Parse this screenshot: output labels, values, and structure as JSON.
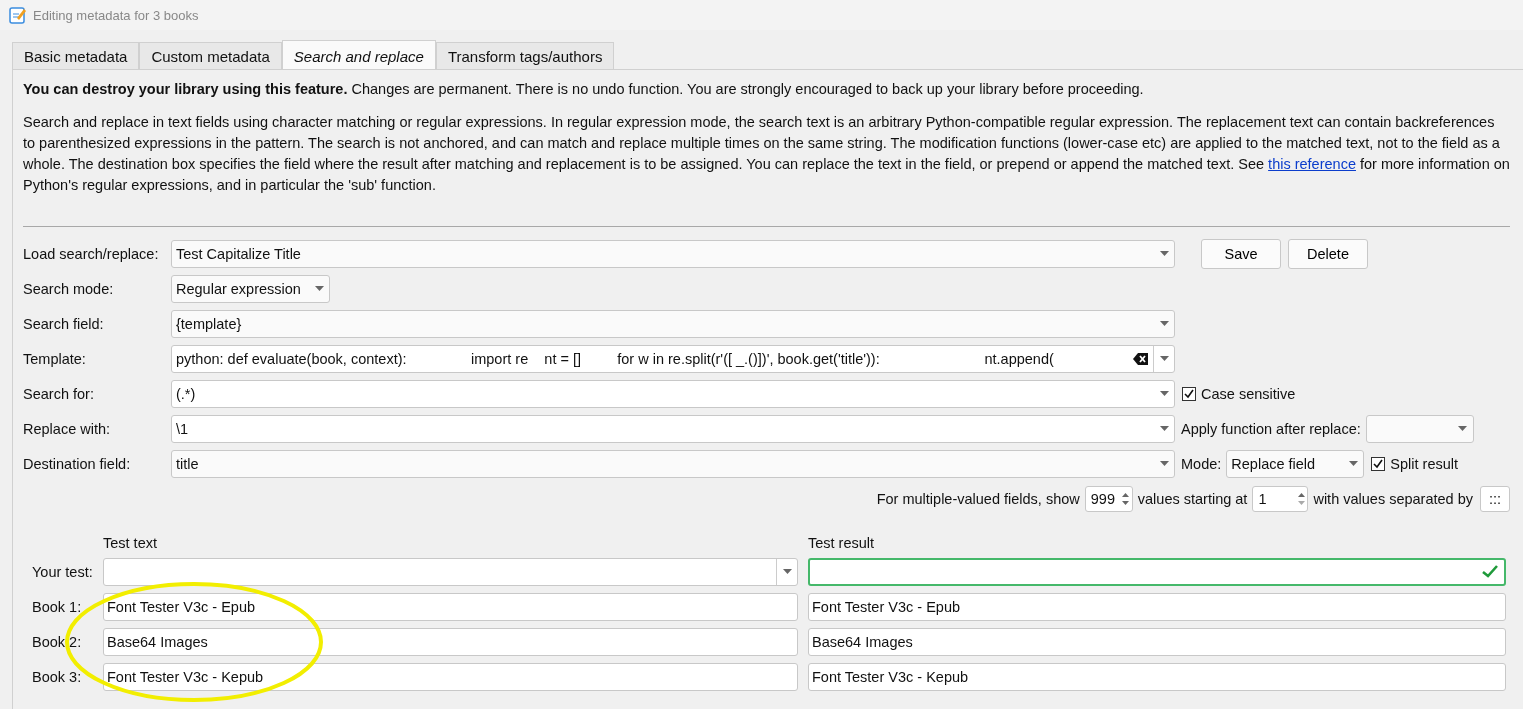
{
  "window": {
    "title": "Editing metadata for 3 books"
  },
  "tabs": [
    {
      "label": "Basic metadata",
      "selected": false
    },
    {
      "label": "Custom metadata",
      "selected": false
    },
    {
      "label": "Search and replace",
      "selected": true
    },
    {
      "label": "Transform tags/authors",
      "selected": false
    }
  ],
  "warning": "**You can destroy your library using this feature.** Changes are permanent. There is no undo function. You are strongly encouraged to back up your library before proceeding.",
  "description": {
    "before": "Search and replace in text fields using character matching or regular expressions. In regular expression mode, the search text is an arbitrary Python-compatible regular expression. The replacement text can contain backreferences to parenthesized expressions in the pattern. The search is not anchored, and can match and replace multiple times on the same string. The modification functions (lower-case etc) are applied to the matched text, not to the field as a whole. The destination box specifies the field where the result after matching and replacement is to be assigned. You can replace the text in the field, or prepend or append the matched text. See",
    "link": "this reference",
    "after": "for more information on Python's regular expressions, and in particular the 'sub' function."
  },
  "load": {
    "label": "Load search/replace:",
    "value": "Test Capitalize Title"
  },
  "buttons": [
    "Save",
    "Delete"
  ],
  "search_mode": {
    "label": "Search mode:",
    "value": "Regular expression"
  },
  "search_field": {
    "label": "Search field:",
    "value": "{template}"
  },
  "template": {
    "label": "Template:",
    "value": "python: def evaluate(book, context):                import re    nt = []         for w in re.split(r'([ _.()])', book.get('title')):                          nt.append("
  },
  "search_for": {
    "label": "Search for:",
    "value": "(.*)"
  },
  "case_sensitive": {
    "label": "Case sensitive",
    "checked": true
  },
  "replace_with": {
    "label": "Replace with:",
    "value": "\\1"
  },
  "apply_function": {
    "label": "Apply function after replace:"
  },
  "destination": {
    "label": "Destination field:",
    "value": "title"
  },
  "mode": {
    "label": "Mode:",
    "value": "Replace field"
  },
  "split_result": {
    "label": "Split result",
    "checked": true
  },
  "multi": {
    "show_label": "For multiple-valued fields, show",
    "show_value": "999",
    "start_label": "values starting at",
    "start_value": "1",
    "sep_label": "with values separated by",
    "sep_value": ":::"
  },
  "test": {
    "text_heading": "Test text",
    "result_heading": "Test result",
    "your_test_label": "Your test:",
    "result_valid": true,
    "books": [
      {
        "label": "Book 1:",
        "text": "Font Tester V3c - Epub",
        "result": "Font Tester V3c - Epub"
      },
      {
        "label": "Book 2:",
        "text": "Base64 Images",
        "result": "Base64 Images"
      },
      {
        "label": "Book 3:",
        "text": "Font Tester V3c - Kepub",
        "result": "Font Tester V3c - Kepub"
      }
    ]
  }
}
